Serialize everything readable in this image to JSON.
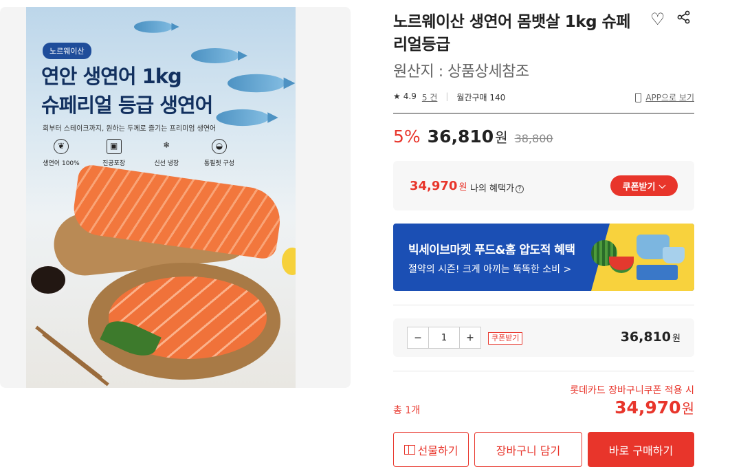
{
  "product_image": {
    "badge": "노르웨이산",
    "headline_line1": "연안 생연어 1kg",
    "headline_line2": "슈페리얼 등급 생연어",
    "subtext": "회부터 스테이크까지, 원하는 두께로 즐기는 프리미엄 생연어",
    "features": [
      {
        "icon": "leaf-icon",
        "glyph": "❦",
        "label": "생연어 100%"
      },
      {
        "icon": "vacuum-pack-icon",
        "glyph": "▣",
        "label": "진공포장"
      },
      {
        "icon": "snowflake-icon",
        "glyph": "❄",
        "label": "신선 냉장"
      },
      {
        "icon": "fillet-icon",
        "glyph": "◒",
        "label": "통필렛 구성"
      }
    ]
  },
  "product": {
    "title": "노르웨이산 생연어 몸뱃살 1kg 슈페리얼등급",
    "origin": "원산지 : 상품상세참조",
    "rating": "4.9",
    "reviews": "5 건",
    "monthly_purchases": "월간구매 140",
    "app_link": "APP으로 보기"
  },
  "pricing": {
    "discount": "5%",
    "price": "36,810",
    "price_unit": "원",
    "original_price": "38,800"
  },
  "benefit": {
    "price": "34,970",
    "unit": "원",
    "label": "나의 혜택가",
    "help": "?",
    "coupon_button": "쿠폰받기"
  },
  "banner": {
    "title": "빅세이브마켓 푸드&홈 압도적 혜택",
    "subtitle": "절약의 시즌! 크게 아끼는 똑똑한 소비 >"
  },
  "quantity": {
    "minus": "−",
    "value": "1",
    "plus": "+",
    "coupon_tag": "쿠폰받기",
    "price": "36,810",
    "unit": "원"
  },
  "summary": {
    "card_note": "롯데카드 장바구니쿠폰 적용 시",
    "total_label": "총 1개",
    "total_price": "34,970",
    "total_unit": "원"
  },
  "actions": {
    "gift": "선물하기",
    "cart": "장바구니 담기",
    "buy": "바로 구매하기"
  },
  "colors": {
    "accent": "#e8352b",
    "banner_blue": "#1b4fb4",
    "banner_yellow": "#f8d23d"
  }
}
